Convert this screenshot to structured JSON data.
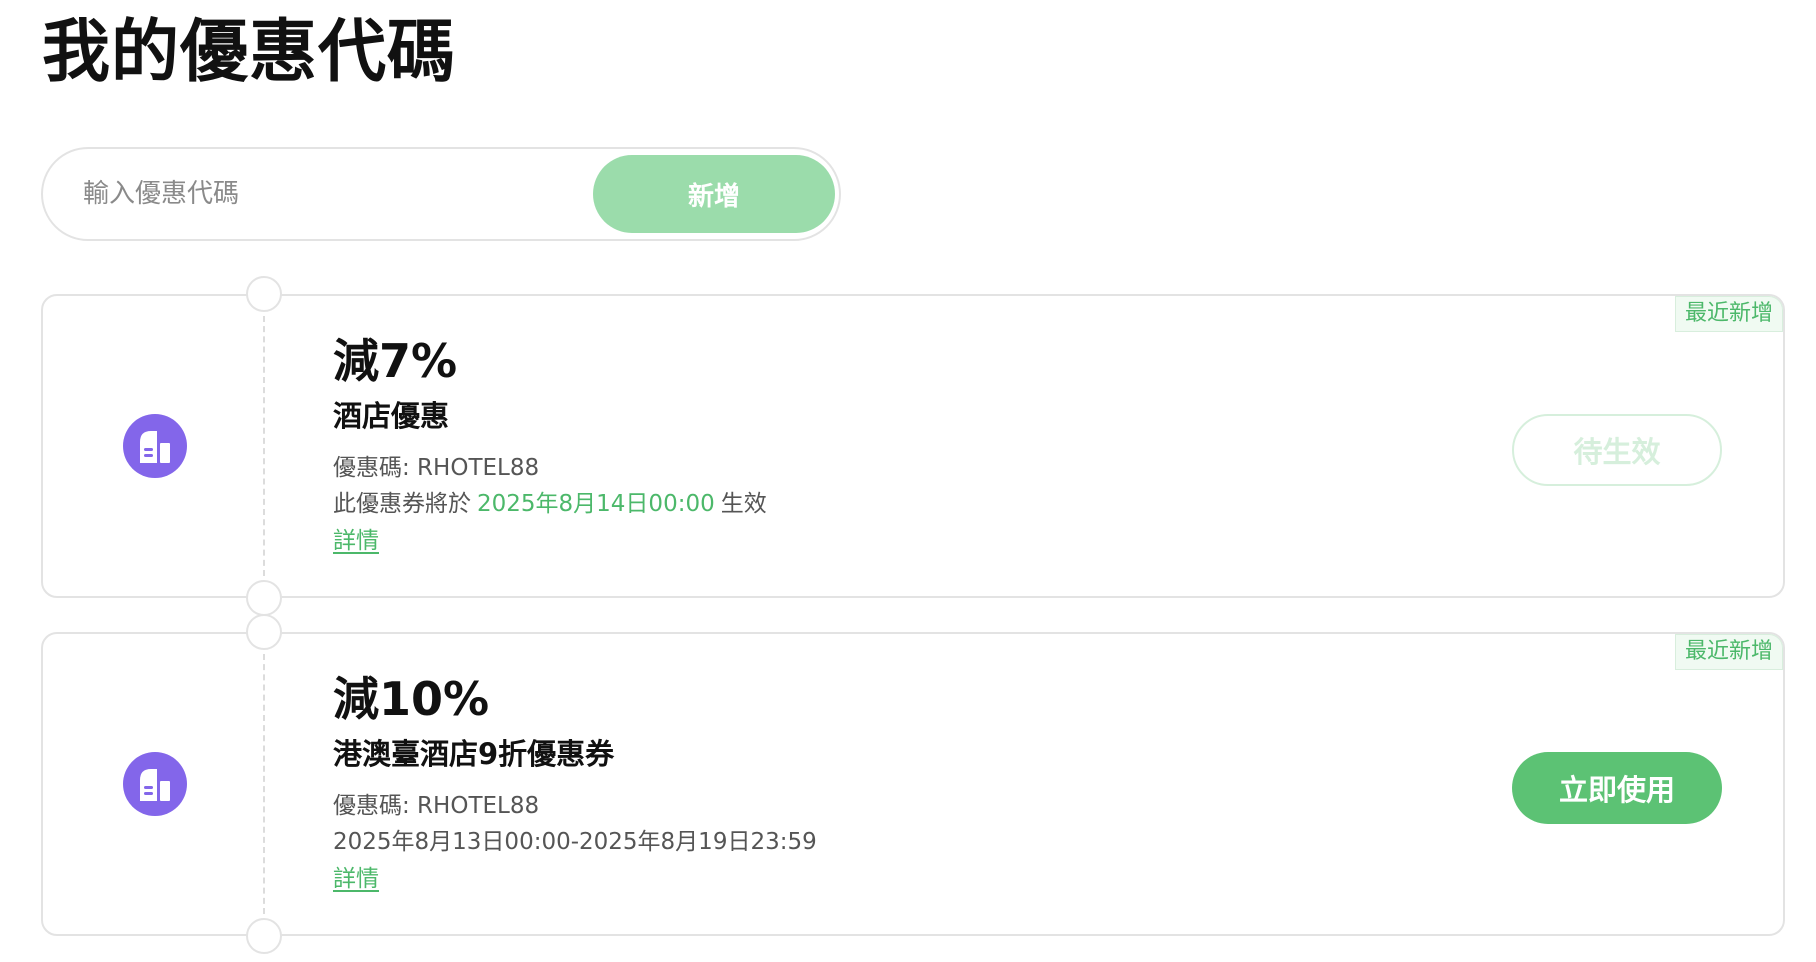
{
  "page": {
    "title": "我的優惠代碼"
  },
  "code_form": {
    "placeholder": "輸入優惠代碼",
    "value": "",
    "add_label": "新增"
  },
  "coupons": [
    {
      "amount": "減7%",
      "name": "酒店優惠",
      "code_text": "優惠碼: RHOTEL88",
      "validity_prefix": "此優惠券將於",
      "validity_date": "2025年8月14日00:00",
      "validity_suffix": "生效",
      "details_label": "詳情",
      "tag": "最近新增",
      "action_label": "待生效",
      "action_state": "pending",
      "icon": "hotel-building-icon"
    },
    {
      "amount": "減10%",
      "name": "港澳臺酒店9折優惠券",
      "code_text": "優惠碼: RHOTEL88",
      "validity_range": "2025年8月13日00:00-2025年8月19日23:59",
      "details_label": "詳情",
      "tag": "最近新增",
      "action_label": "立即使用",
      "action_state": "active",
      "icon": "hotel-building-icon"
    }
  ],
  "colors": {
    "accent_green": "#4cb86a",
    "button_green": "#5cc274",
    "button_green_light": "#9bdcab",
    "icon_purple": "#8366ea",
    "border": "#e3e3e3"
  }
}
